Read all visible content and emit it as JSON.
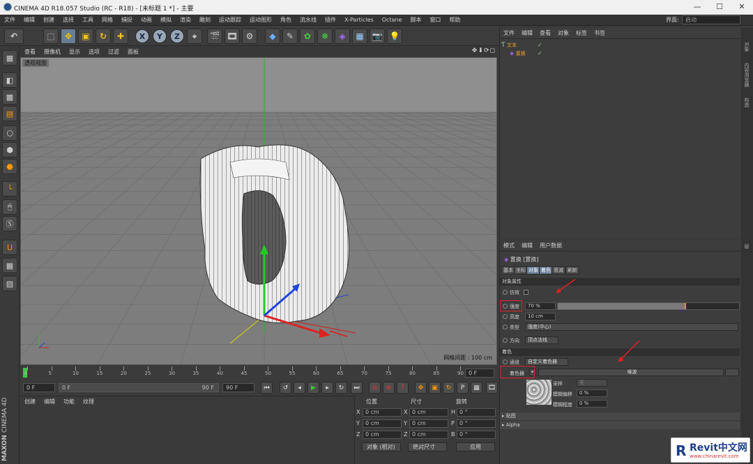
{
  "window": {
    "title": "CINEMA 4D R18.057 Studio (RC - R18) - [未标题 1 *] - 主要",
    "min": "—",
    "max": "☐",
    "close": "✕"
  },
  "menu": [
    "文件",
    "编辑",
    "创建",
    "选择",
    "工具",
    "网格",
    "捕捉",
    "动画",
    "模拟",
    "渲染",
    "雕刻",
    "运动跟踪",
    "运动图形",
    "角色",
    "流水线",
    "插件",
    "X-Particles",
    "Octane",
    "脚本",
    "窗口",
    "帮助"
  ],
  "layout": {
    "label": "界面:",
    "value": "启动"
  },
  "toolbar": {
    "x": "X",
    "y": "Y",
    "z": "Z"
  },
  "viewport": {
    "menu": [
      "查看",
      "摄像机",
      "显示",
      "选项",
      "过滤",
      "面板"
    ],
    "label": "透视视图",
    "grid_spacing": "网格间距 : 100 cm",
    "nav": "✥⬇⟳◻"
  },
  "timeline": {
    "ticks": [
      "0",
      "5",
      "10",
      "15",
      "20",
      "25",
      "30",
      "35",
      "40",
      "45",
      "50",
      "55",
      "60",
      "65",
      "70",
      "75",
      "80",
      "85",
      "90"
    ],
    "current": "0 F"
  },
  "transport": {
    "start": "0 F",
    "range_start": "0 F",
    "range_end": "90 F",
    "end": "90 F"
  },
  "material_manager": {
    "menu": [
      "创建",
      "编辑",
      "功能",
      "纹理"
    ]
  },
  "brand": {
    "maxon": "MAXON",
    "cinema": "CINEMA 4D"
  },
  "coords": {
    "headers": [
      "位置",
      "尺寸",
      "旋转"
    ],
    "rows": [
      {
        "axis": "X",
        "pos": "0 cm",
        "saxis": "X",
        "size": "0 cm",
        "raxis": "H",
        "rot": "0 °"
      },
      {
        "axis": "Y",
        "pos": "0 cm",
        "saxis": "Y",
        "size": "0 cm",
        "raxis": "P",
        "rot": "0 °"
      },
      {
        "axis": "Z",
        "pos": "0 cm",
        "saxis": "Z",
        "size": "0 cm",
        "raxis": "B",
        "rot": "0 °"
      }
    ],
    "mode": "对象 (相对)",
    "size_mode": "绝对尺寸",
    "apply": "应用"
  },
  "object_manager": {
    "menu": [
      "文件",
      "编辑",
      "查看",
      "对象",
      "标签",
      "书签"
    ],
    "objects": [
      {
        "name": "文本",
        "icon": "text-object-icon"
      },
      {
        "name": "置换",
        "icon": "displace-deformer-icon"
      }
    ]
  },
  "right_tabs": [
    "对象",
    "内容浏览器",
    "构造",
    "层"
  ],
  "attributes": {
    "menu": [
      "模式",
      "编辑",
      "用户数据"
    ],
    "title": "置换 [置换]",
    "tabs": [
      "基本",
      "坐标",
      "对象",
      "着色",
      "衰减",
      "刷新"
    ],
    "section_object": "对象属性",
    "fields": {
      "imitate": "仿效",
      "strength_label": "强度",
      "strength_value": "70 %",
      "height_label": "高度",
      "height_value": "10 cm",
      "type_label": "类型",
      "type_value": "强度(中心)",
      "direction_label": "方向",
      "direction_value": "顶点法线"
    },
    "strength_fraction": 0.7,
    "section_shading": "着色",
    "channel_label": "通道",
    "channel_value": "自定义着色器",
    "shader_label": "着色器",
    "shader_value": "噪波",
    "sampling_label": "采样",
    "sampling_value": "无",
    "blur_offset_label": "模糊偏移",
    "blur_offset_value": "0 %",
    "blur_scale_label": "模糊程度",
    "blur_scale_value": "0 %",
    "sub_sections": [
      "贴图",
      "Alpha"
    ]
  },
  "watermark": {
    "brand": "Revit中文网",
    "url": "www.chinarevit.com"
  },
  "colors": {
    "accent": "#6a7d96",
    "axis_x": "#d02020",
    "axis_y": "#20c020",
    "axis_z": "#2040d0",
    "strength_bar": "#e0902a"
  }
}
